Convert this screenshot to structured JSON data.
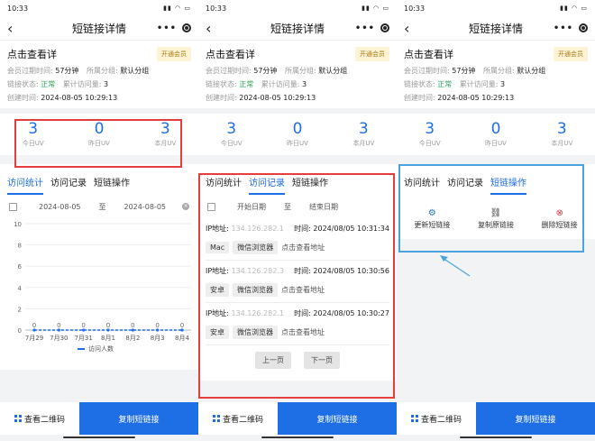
{
  "screens": [
    {
      "status_time": "10:33",
      "nav_title": "短链接详情",
      "info": {
        "title": "点击查看详",
        "vip_badge": "开通会员",
        "expire_label": "会员过期时间:",
        "expire_value": "57分钟",
        "group_label": "所属分组:",
        "group_value": "默认分组",
        "status_label": "链接状态:",
        "status_value": "正常",
        "visits_label": "累计访问量:",
        "visits_value": "3",
        "created_label": "创建时间:",
        "created_value": "2024-08-05 10:29:13"
      },
      "uv": [
        {
          "value": "3",
          "label": "今日UV"
        },
        {
          "value": "0",
          "label": "昨日UV"
        },
        {
          "value": "3",
          "label": "本月UV"
        }
      ],
      "tabs": [
        "访问统计",
        "访问记录",
        "短链操作"
      ],
      "active_tab": 0,
      "date_start": "2024-08-05",
      "date_sep": "至",
      "date_end": "2024-08-05",
      "bottom": {
        "qr_label": "查看二维码",
        "copy_label": "复制短链接"
      }
    },
    {
      "status_time": "10:33",
      "nav_title": "短链接详情",
      "info": {
        "title": "点击查看详",
        "vip_badge": "开通会员",
        "expire_label": "会员过期时间:",
        "expire_value": "57分钟",
        "group_label": "所属分组:",
        "group_value": "默认分组",
        "status_label": "链接状态:",
        "status_value": "正常",
        "visits_label": "累计访问量:",
        "visits_value": "3",
        "created_label": "创建时间:",
        "created_value": "2024-08-05 10:29:13"
      },
      "uv": [
        {
          "value": "3",
          "label": "今日UV"
        },
        {
          "value": "0",
          "label": "昨日UV"
        },
        {
          "value": "3",
          "label": "本月UV"
        }
      ],
      "tabs": [
        "访问统计",
        "访问记录",
        "短链操作"
      ],
      "active_tab": 1,
      "date_start": "开始日期",
      "date_sep": "至",
      "date_end": "结束日期",
      "records": [
        {
          "ip_label": "IP地址:",
          "ip": "134.126.282.1",
          "time_label": "时间:",
          "time": "2024/08/05 10:31:34",
          "os": "Mac",
          "browser": "微信浏览器",
          "link": "点击查看地址"
        },
        {
          "ip_label": "IP地址:",
          "ip": "134.126.282.3",
          "time_label": "时间:",
          "time": "2024/08/05 10:30:56",
          "os": "安卓",
          "browser": "微信浏览器",
          "link": "点击查看地址"
        },
        {
          "ip_label": "IP地址:",
          "ip": "134.126.282.1",
          "time_label": "时间:",
          "time": "2024/08/05 10:30:27",
          "os": "安卓",
          "browser": "微信浏览器",
          "link": "点击查看地址"
        }
      ],
      "pager": {
        "prev": "上一页",
        "next": "下一页"
      },
      "bottom": {
        "qr_label": "查看二维码",
        "copy_label": "复制短链接"
      }
    },
    {
      "status_time": "10:33",
      "nav_title": "短链接详情",
      "info": {
        "title": "点击查看详",
        "vip_badge": "开通会员",
        "expire_label": "会员过期时间:",
        "expire_value": "57分钟",
        "group_label": "所属分组:",
        "group_value": "默认分组",
        "status_label": "链接状态:",
        "status_value": "正常",
        "visits_label": "累计访问量:",
        "visits_value": "3",
        "created_label": "创建时间:",
        "created_value": "2024-08-05 10:29:13"
      },
      "uv": [
        {
          "value": "3",
          "label": "今日UV"
        },
        {
          "value": "0",
          "label": "昨日UV"
        },
        {
          "value": "3",
          "label": "本月UV"
        }
      ],
      "tabs": [
        "访问统计",
        "访问记录",
        "短链操作"
      ],
      "active_tab": 2,
      "ops": [
        {
          "label": "更新短链接",
          "icon": "gear-icon"
        },
        {
          "label": "复制原链接",
          "icon": "link-icon"
        },
        {
          "label": "删除短链接",
          "icon": "delete-icon"
        }
      ],
      "bottom": {
        "qr_label": "查看二维码",
        "copy_label": "复制短链接"
      }
    }
  ],
  "chart_data": {
    "type": "line",
    "categories": [
      "7月29",
      "7月30",
      "7月31",
      "8月1",
      "8月2",
      "8月3",
      "8月4"
    ],
    "series": [
      {
        "name": "访问人数",
        "values": [
          0,
          0,
          0,
          0,
          0,
          0,
          0
        ]
      }
    ],
    "ylim": [
      0,
      10
    ],
    "yticks": [
      0,
      2,
      4,
      6,
      8,
      10
    ],
    "grid": true,
    "legend": "bottom",
    "color": "#1e6ee6"
  }
}
